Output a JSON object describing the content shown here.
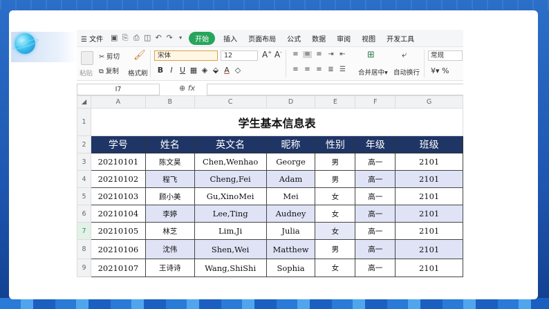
{
  "menubar": {
    "file": "文件",
    "start": "开始",
    "tabs": [
      "插入",
      "页面布局",
      "公式",
      "数据",
      "审阅",
      "视图",
      "开发工具"
    ]
  },
  "ribbon": {
    "paste": "粘贴",
    "cut": "剪切",
    "copy": "复制",
    "format_painter": "格式刷",
    "font_name": "宋体",
    "font_size": "12",
    "merge_center": "合并居中",
    "wrap_text": "自动换行",
    "number_format": "常规",
    "currency": "¥",
    "percent": "%"
  },
  "formula_bar": {
    "name_box": "I7",
    "fx": "fx"
  },
  "sheet": {
    "columns": [
      "A",
      "B",
      "C",
      "D",
      "E",
      "F",
      "G"
    ],
    "row_numbers": [
      "1",
      "2",
      "3",
      "4",
      "5",
      "6",
      "7",
      "8",
      "9"
    ],
    "selected_row": "7",
    "title": "学生基本信息表",
    "headers": [
      "学号",
      "姓名",
      "英文名",
      "昵称",
      "性别",
      "年级",
      "班级"
    ],
    "rows": [
      [
        "20210101",
        "陈文昊",
        "Chen,Wenhao",
        "George",
        "男",
        "高一",
        "2101"
      ],
      [
        "20210102",
        "程飞",
        "Cheng,Fei",
        "Adam",
        "男",
        "高一",
        "2101"
      ],
      [
        "20210103",
        "顾小美",
        "Gu,XinoMei",
        "Mei",
        "女",
        "高一",
        "2101"
      ],
      [
        "20210104",
        "李婷",
        "Lee,Ting",
        "Audney",
        "女",
        "高一",
        "2101"
      ],
      [
        "20210105",
        "林芝",
        "Lim,Ji",
        "Julia",
        "女",
        "高一",
        "2101"
      ],
      [
        "20210106",
        "沈伟",
        "Shen,Wei",
        "Matthew",
        "男",
        "高一",
        "2101"
      ],
      [
        "20210107",
        "王诗诗",
        "Wang,ShiShi",
        "Sophia",
        "女",
        "高一",
        "2101"
      ]
    ]
  },
  "colors": {
    "header_fill": "#1f3566",
    "alt_fill": "#dfe3f5",
    "start_tab": "#27a55b"
  }
}
